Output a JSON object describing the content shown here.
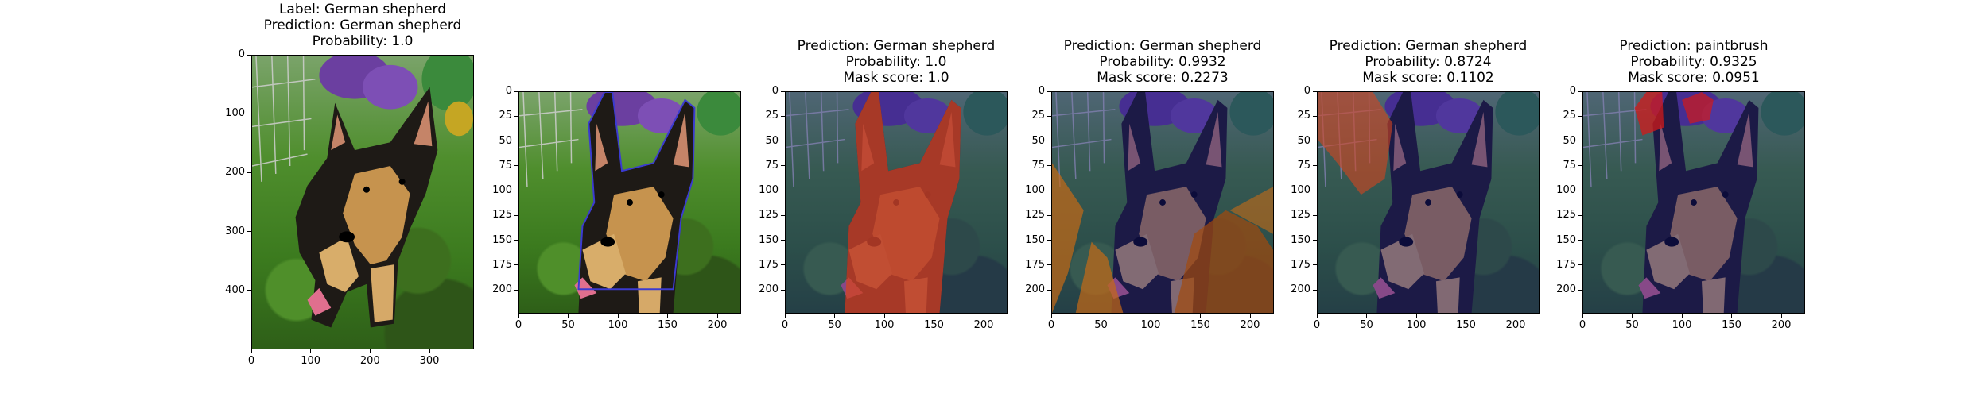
{
  "panels": [
    {
      "title": [
        "Label: German shepherd",
        "Prediction: German shepherd",
        "Probability: 1.0"
      ],
      "overlay": "none",
      "xticks": [
        "0",
        "100",
        "200",
        "300"
      ],
      "yticks": [
        "0",
        "100",
        "200",
        "300",
        "400"
      ]
    },
    {
      "title": [],
      "overlay": "outline",
      "xticks": [
        "0",
        "50",
        "100",
        "150",
        "200"
      ],
      "yticks": [
        "0",
        "25",
        "50",
        "75",
        "100",
        "125",
        "150",
        "175",
        "200"
      ]
    },
    {
      "title": [
        "Prediction: German shepherd",
        "Probability: 1.0",
        "Mask score: 1.0"
      ],
      "overlay": "dog-red",
      "xticks": [
        "0",
        "50",
        "100",
        "150",
        "200"
      ],
      "yticks": [
        "0",
        "25",
        "50",
        "75",
        "100",
        "125",
        "150",
        "175",
        "200"
      ]
    },
    {
      "title": [
        "Prediction: German shepherd",
        "Probability: 0.9932",
        "Mask score: 0.2273"
      ],
      "overlay": "ground-orange",
      "xticks": [
        "0",
        "50",
        "100",
        "150",
        "200"
      ],
      "yticks": [
        "0",
        "25",
        "50",
        "75",
        "100",
        "125",
        "150",
        "175",
        "200"
      ]
    },
    {
      "title": [
        "Prediction: German shepherd",
        "Probability: 0.8724",
        "Mask score: 0.1102"
      ],
      "overlay": "fence-orange",
      "xticks": [
        "0",
        "50",
        "100",
        "150",
        "200"
      ],
      "yticks": [
        "0",
        "25",
        "50",
        "75",
        "100",
        "125",
        "150",
        "175",
        "200"
      ]
    },
    {
      "title": [
        "Prediction: paintbrush",
        "Probability: 0.9325",
        "Mask score: 0.0951"
      ],
      "overlay": "ears-red",
      "xticks": [
        "0",
        "50",
        "100",
        "150",
        "200"
      ],
      "yticks": [
        "0",
        "25",
        "50",
        "75",
        "100",
        "125",
        "150",
        "175",
        "200"
      ]
    }
  ]
}
